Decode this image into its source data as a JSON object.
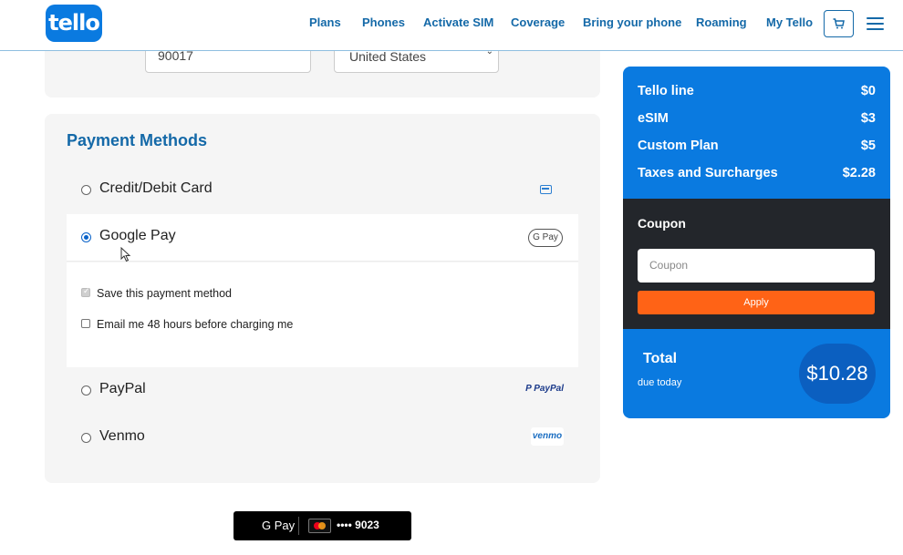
{
  "header": {
    "logo_text": "tello",
    "nav": [
      "Plans",
      "Phones",
      "Activate SIM",
      "Coverage",
      "Bring your phone",
      "Roaming",
      "My Tello"
    ]
  },
  "address": {
    "zip_value": "90017",
    "country_value": "United States"
  },
  "payment": {
    "title": "Payment Methods",
    "options": [
      {
        "label": "Credit/Debit Card",
        "selected": false,
        "icon": "credit-card-icon"
      },
      {
        "label": "Google Pay",
        "selected": true,
        "icon": "google-pay-icon",
        "badge": "G Pay"
      },
      {
        "label": "PayPal",
        "selected": false,
        "icon": "paypal-icon",
        "badge": "PayPal"
      },
      {
        "label": "Venmo",
        "selected": false,
        "icon": "venmo-icon",
        "badge": "venmo"
      }
    ],
    "save_method_label": "Save this payment method",
    "save_method_checked": true,
    "email_label": "Email me 48 hours before charging me",
    "email_checked": false
  },
  "gpay_button": {
    "brand": "G Pay",
    "card_digits": "•••• 9023"
  },
  "summary": {
    "lines": [
      {
        "label": "Tello line",
        "value": "$0"
      },
      {
        "label": "eSIM",
        "value": "$3"
      },
      {
        "label": "Custom Plan",
        "value": "$5"
      },
      {
        "label": "Taxes and Surcharges",
        "value": "$2.28"
      }
    ],
    "coupon_title": "Coupon",
    "coupon_placeholder": "Coupon",
    "apply_label": "Apply",
    "total_label": "Total",
    "due_label": "due today",
    "total_value": "$10.28"
  },
  "colors": {
    "brand_blue": "#0a7ae0",
    "link_blue": "#1469a8",
    "apply_orange": "#ff6316",
    "dark_panel": "#23262b"
  }
}
